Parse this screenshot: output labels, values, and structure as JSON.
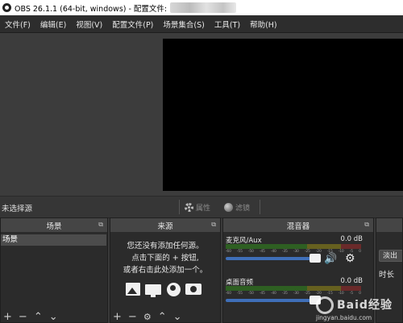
{
  "window": {
    "title": "OBS 26.1.1 (64-bit, windows) - 配置文件:"
  },
  "menu": [
    "文件(F)",
    "编辑(E)",
    "视图(V)",
    "配置文件(P)",
    "场景集合(S)",
    "工具(T)",
    "帮助(H)"
  ],
  "source_toolbar": {
    "no_source": "未选择源",
    "properties": "属性",
    "filters": "滤镜"
  },
  "docks": {
    "scenes": {
      "title": "场景",
      "items": [
        "场景"
      ]
    },
    "sources": {
      "title": "来源",
      "hint_line1": "您还没有添加任何源。",
      "hint_line2": "点击下面的 + 按钮,",
      "hint_line3": "或者右击此处添加一个。"
    },
    "mixer": {
      "title": "混音器",
      "channels": [
        {
          "name": "麦克风/Aux",
          "db": "0.0 dB",
          "level": 1.0
        },
        {
          "name": "桌面音频",
          "db": "0.0 dB",
          "level": 1.0
        }
      ],
      "scale": [
        "-60",
        "-55",
        "-50",
        "-45",
        "-40",
        "-35",
        "-30",
        "-25",
        "-20",
        "-15",
        "-10",
        "-5",
        "0"
      ]
    },
    "transitions": {
      "button": "淡出",
      "duration_label": "时长"
    }
  },
  "icons": {
    "float": "⧉",
    "speaker": "🔊",
    "gear": "⚙",
    "footer_scenes": [
      "+",
      "−",
      "⌃",
      "⌄"
    ],
    "footer_sources": [
      "+",
      "−",
      "⚙",
      "⌃",
      "⌄"
    ]
  },
  "watermark": {
    "text": "Baid经验",
    "url": "jingyan.baidu.com"
  }
}
